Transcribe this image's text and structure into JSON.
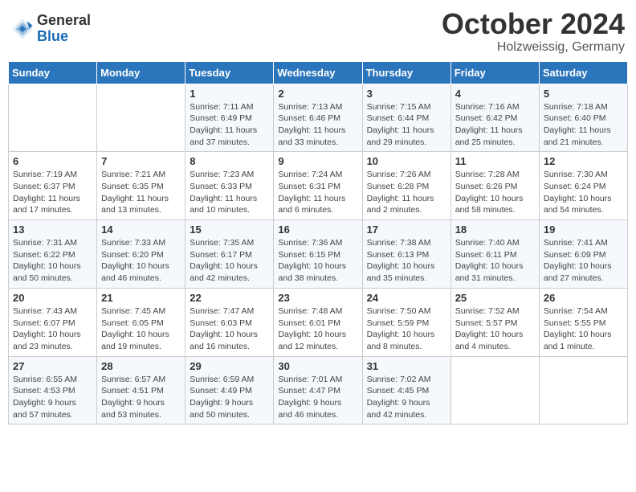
{
  "logo": {
    "general": "General",
    "blue": "Blue"
  },
  "header": {
    "month": "October 2024",
    "location": "Holzweissig, Germany"
  },
  "weekdays": [
    "Sunday",
    "Monday",
    "Tuesday",
    "Wednesday",
    "Thursday",
    "Friday",
    "Saturday"
  ],
  "weeks": [
    [
      {
        "day": "",
        "info": ""
      },
      {
        "day": "",
        "info": ""
      },
      {
        "day": "1",
        "info": "Sunrise: 7:11 AM\nSunset: 6:49 PM\nDaylight: 11 hours\nand 37 minutes."
      },
      {
        "day": "2",
        "info": "Sunrise: 7:13 AM\nSunset: 6:46 PM\nDaylight: 11 hours\nand 33 minutes."
      },
      {
        "day": "3",
        "info": "Sunrise: 7:15 AM\nSunset: 6:44 PM\nDaylight: 11 hours\nand 29 minutes."
      },
      {
        "day": "4",
        "info": "Sunrise: 7:16 AM\nSunset: 6:42 PM\nDaylight: 11 hours\nand 25 minutes."
      },
      {
        "day": "5",
        "info": "Sunrise: 7:18 AM\nSunset: 6:40 PM\nDaylight: 11 hours\nand 21 minutes."
      }
    ],
    [
      {
        "day": "6",
        "info": "Sunrise: 7:19 AM\nSunset: 6:37 PM\nDaylight: 11 hours\nand 17 minutes."
      },
      {
        "day": "7",
        "info": "Sunrise: 7:21 AM\nSunset: 6:35 PM\nDaylight: 11 hours\nand 13 minutes."
      },
      {
        "day": "8",
        "info": "Sunrise: 7:23 AM\nSunset: 6:33 PM\nDaylight: 11 hours\nand 10 minutes."
      },
      {
        "day": "9",
        "info": "Sunrise: 7:24 AM\nSunset: 6:31 PM\nDaylight: 11 hours\nand 6 minutes."
      },
      {
        "day": "10",
        "info": "Sunrise: 7:26 AM\nSunset: 6:28 PM\nDaylight: 11 hours\nand 2 minutes."
      },
      {
        "day": "11",
        "info": "Sunrise: 7:28 AM\nSunset: 6:26 PM\nDaylight: 10 hours\nand 58 minutes."
      },
      {
        "day": "12",
        "info": "Sunrise: 7:30 AM\nSunset: 6:24 PM\nDaylight: 10 hours\nand 54 minutes."
      }
    ],
    [
      {
        "day": "13",
        "info": "Sunrise: 7:31 AM\nSunset: 6:22 PM\nDaylight: 10 hours\nand 50 minutes."
      },
      {
        "day": "14",
        "info": "Sunrise: 7:33 AM\nSunset: 6:20 PM\nDaylight: 10 hours\nand 46 minutes."
      },
      {
        "day": "15",
        "info": "Sunrise: 7:35 AM\nSunset: 6:17 PM\nDaylight: 10 hours\nand 42 minutes."
      },
      {
        "day": "16",
        "info": "Sunrise: 7:36 AM\nSunset: 6:15 PM\nDaylight: 10 hours\nand 38 minutes."
      },
      {
        "day": "17",
        "info": "Sunrise: 7:38 AM\nSunset: 6:13 PM\nDaylight: 10 hours\nand 35 minutes."
      },
      {
        "day": "18",
        "info": "Sunrise: 7:40 AM\nSunset: 6:11 PM\nDaylight: 10 hours\nand 31 minutes."
      },
      {
        "day": "19",
        "info": "Sunrise: 7:41 AM\nSunset: 6:09 PM\nDaylight: 10 hours\nand 27 minutes."
      }
    ],
    [
      {
        "day": "20",
        "info": "Sunrise: 7:43 AM\nSunset: 6:07 PM\nDaylight: 10 hours\nand 23 minutes."
      },
      {
        "day": "21",
        "info": "Sunrise: 7:45 AM\nSunset: 6:05 PM\nDaylight: 10 hours\nand 19 minutes."
      },
      {
        "day": "22",
        "info": "Sunrise: 7:47 AM\nSunset: 6:03 PM\nDaylight: 10 hours\nand 16 minutes."
      },
      {
        "day": "23",
        "info": "Sunrise: 7:48 AM\nSunset: 6:01 PM\nDaylight: 10 hours\nand 12 minutes."
      },
      {
        "day": "24",
        "info": "Sunrise: 7:50 AM\nSunset: 5:59 PM\nDaylight: 10 hours\nand 8 minutes."
      },
      {
        "day": "25",
        "info": "Sunrise: 7:52 AM\nSunset: 5:57 PM\nDaylight: 10 hours\nand 4 minutes."
      },
      {
        "day": "26",
        "info": "Sunrise: 7:54 AM\nSunset: 5:55 PM\nDaylight: 10 hours\nand 1 minute."
      }
    ],
    [
      {
        "day": "27",
        "info": "Sunrise: 6:55 AM\nSunset: 4:53 PM\nDaylight: 9 hours\nand 57 minutes."
      },
      {
        "day": "28",
        "info": "Sunrise: 6:57 AM\nSunset: 4:51 PM\nDaylight: 9 hours\nand 53 minutes."
      },
      {
        "day": "29",
        "info": "Sunrise: 6:59 AM\nSunset: 4:49 PM\nDaylight: 9 hours\nand 50 minutes."
      },
      {
        "day": "30",
        "info": "Sunrise: 7:01 AM\nSunset: 4:47 PM\nDaylight: 9 hours\nand 46 minutes."
      },
      {
        "day": "31",
        "info": "Sunrise: 7:02 AM\nSunset: 4:45 PM\nDaylight: 9 hours\nand 42 minutes."
      },
      {
        "day": "",
        "info": ""
      },
      {
        "day": "",
        "info": ""
      }
    ]
  ]
}
